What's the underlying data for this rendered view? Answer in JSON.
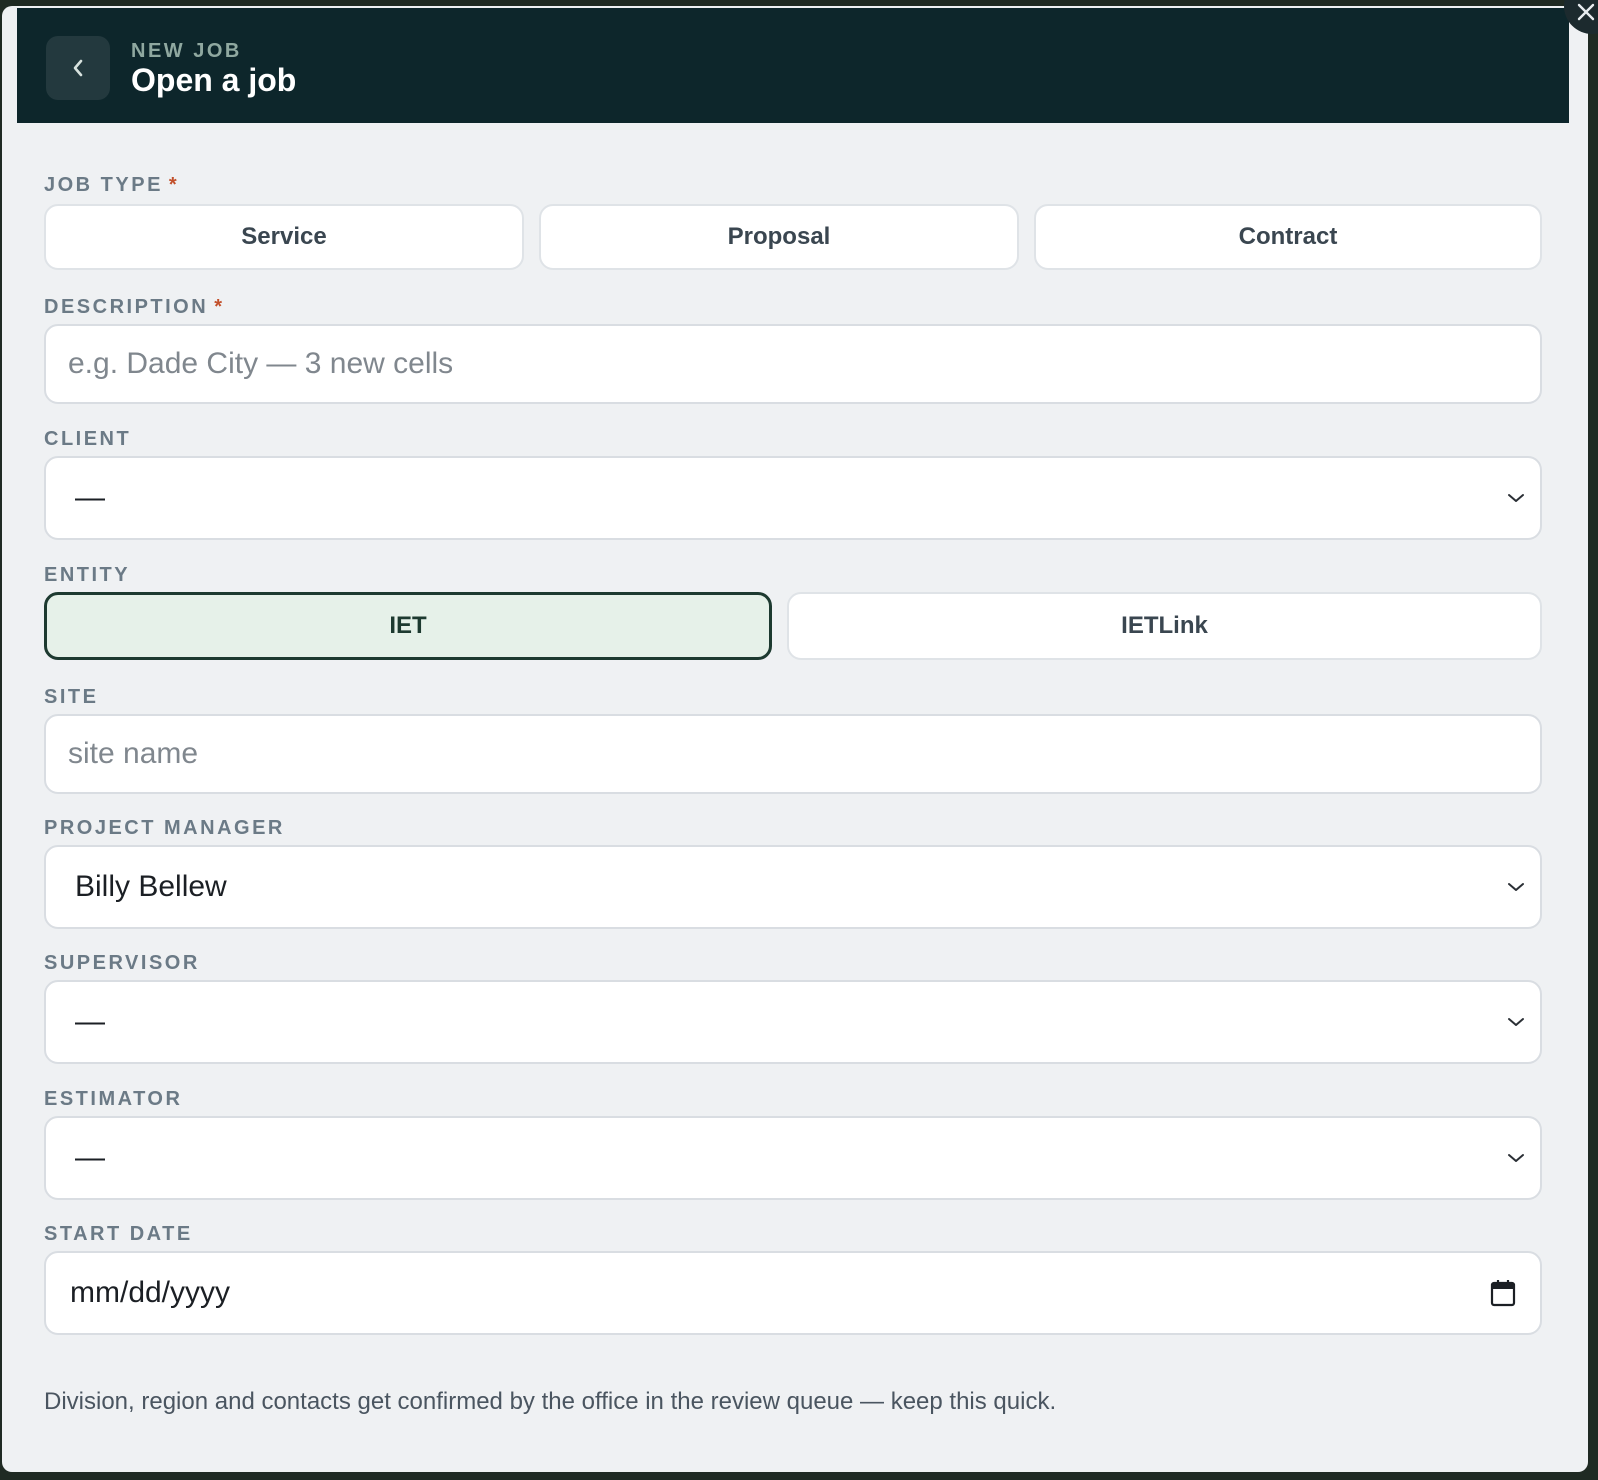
{
  "header": {
    "eyebrow": "NEW JOB",
    "title": "Open a job",
    "back_icon": "chevron-left-icon",
    "close_icon": "close-icon",
    "bg_color": "#0d262b"
  },
  "job_type": {
    "label": "JOB TYPE",
    "required_mark": "*",
    "options": [
      "Service",
      "Proposal",
      "Contract"
    ]
  },
  "description": {
    "label": "DESCRIPTION",
    "required_mark": "*",
    "placeholder": "e.g. Dade City — 3 new cells"
  },
  "client": {
    "label": "CLIENT",
    "value": "—"
  },
  "entity": {
    "label": "ENTITY",
    "options": [
      "IET",
      "IETLink"
    ],
    "selected": "IET",
    "accent_color": "#1d3a30"
  },
  "site": {
    "label": "SITE",
    "placeholder": "site name"
  },
  "project_manager": {
    "label": "PROJECT MANAGER",
    "value": "Billy Bellew"
  },
  "supervisor": {
    "label": "SUPERVISOR",
    "value": "—"
  },
  "estimator": {
    "label": "ESTIMATOR",
    "value": "—"
  },
  "start_date": {
    "label": "START DATE",
    "value": "mm/dd/yyyy",
    "icon": "calendar-icon"
  },
  "footnote": "Division, region and contacts get confirmed by the office in the review queue — keep this quick."
}
